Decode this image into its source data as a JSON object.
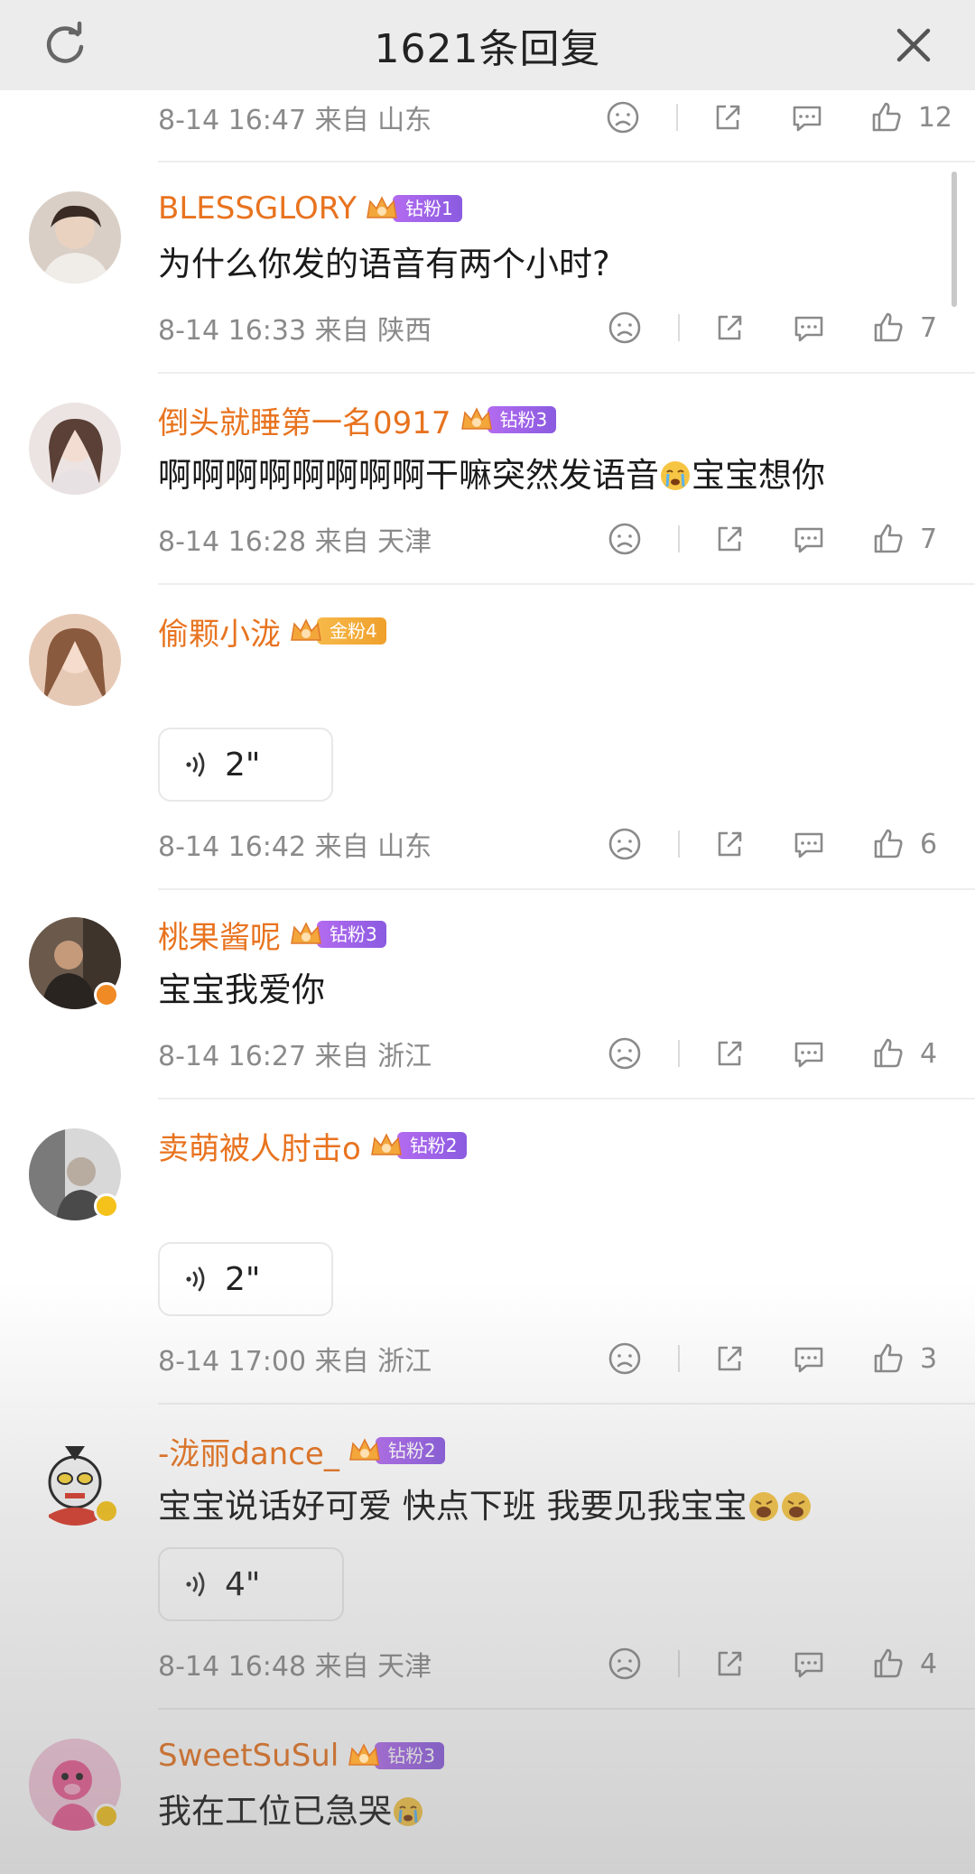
{
  "header": {
    "title": "1621条回复",
    "refresh_icon": "refresh-icon",
    "close_icon": "close-icon"
  },
  "top_meta": {
    "time": "8-14 16:47 来自 山东",
    "likes": "12"
  },
  "comments": [
    {
      "user": "BLESSGLORY",
      "badge": "钻粉1",
      "text": "为什么你发的语音有两个小时?",
      "time": "8-14 16:33 来自 陕西",
      "likes": "7"
    },
    {
      "user": "倒头就睡第一名0917",
      "badge": "钻粉3",
      "text_before": "啊啊啊啊啊啊啊啊干嘛突然发语音",
      "text_after": "宝宝想你",
      "time": "8-14 16:28 来自 天津",
      "likes": "7"
    },
    {
      "user": "偷颗小泷",
      "badge": "金粉4",
      "voice": "2\"",
      "time": "8-14 16:42 来自 山东",
      "likes": "6"
    },
    {
      "user": "桃果酱呢",
      "badge": "钻粉3",
      "text": "宝宝我爱你",
      "time": "8-14 16:27 来自 浙江",
      "likes": "4"
    },
    {
      "user": "卖萌被人肘击o",
      "badge": "钻粉2",
      "voice": "2\"",
      "time": "8-14 17:00 来自 浙江",
      "likes": "3"
    },
    {
      "user": "-泷丽dance_",
      "badge": "钻粉2",
      "text": "宝宝说话好可爱 快点下班 我要见我宝宝",
      "voice": "4\"",
      "time": "8-14 16:48 来自 天津",
      "likes": "4"
    },
    {
      "user": "SweetSuSul",
      "badge": "钻粉3",
      "text": "我在工位已急哭"
    }
  ],
  "colors": {
    "username": "#e8731f",
    "diamond_badge": "#9b63e8",
    "gold_badge": "#f2a93a",
    "meta_text": "#8a8a8a"
  }
}
